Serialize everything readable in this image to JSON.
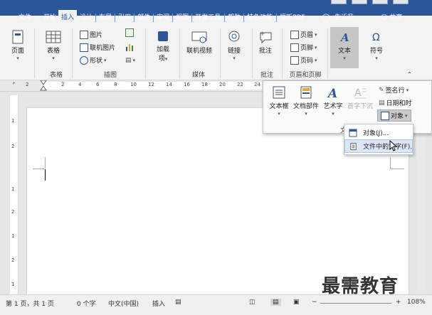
{
  "ribbon_tabs": [
    "文件",
    "开始",
    "插入",
    "设计",
    "布局",
    "引用",
    "邮件",
    "审阅",
    "视图",
    "开发工具",
    "帮助",
    "特色功能",
    "福昕PDF"
  ],
  "active_tab": "插入",
  "tell_me": "告诉我",
  "share": "共享",
  "ribbon": {
    "page": "页面",
    "table": "表格",
    "picture": "图片",
    "online_picture": "联机图片",
    "shapes": "形状",
    "addins": "加载\n项",
    "online_video": "联机视频",
    "link": "链接",
    "comment": "批注",
    "header": "页眉",
    "footer": "页脚",
    "page_number": "页码",
    "text": "文本",
    "symbol": "符号",
    "groups": {
      "tables": "表格",
      "illustrations": "插图",
      "media": "媒体",
      "comments": "批注",
      "header_footer": "页眉和页脚"
    }
  },
  "ruler_ticks": [
    "2",
    "2",
    "4",
    "6",
    "8",
    "10",
    "12",
    "14",
    "16",
    "18",
    "20",
    "22",
    "24"
  ],
  "vruler_ticks": [
    "1",
    "2",
    "1",
    "2",
    "1",
    "2",
    "1"
  ],
  "text_popup": {
    "textbox": "文本框",
    "quickparts": "文档部件",
    "wordart": "艺术字",
    "dropcap": "首字下沉",
    "signature": "签名行",
    "datetime": "日期和时",
    "object": "对象",
    "group": "文"
  },
  "object_menu": {
    "object": "对象(J)...",
    "text_from_file": "文件中的文字(F)..."
  },
  "status": {
    "page": "第 1 页，共 1 页",
    "words": "0 个字",
    "lang": "中文(中国)",
    "insert": "插入",
    "zoom": "108%"
  },
  "watermark": "最需教育",
  "colors": {
    "accent": "#2b579a"
  }
}
